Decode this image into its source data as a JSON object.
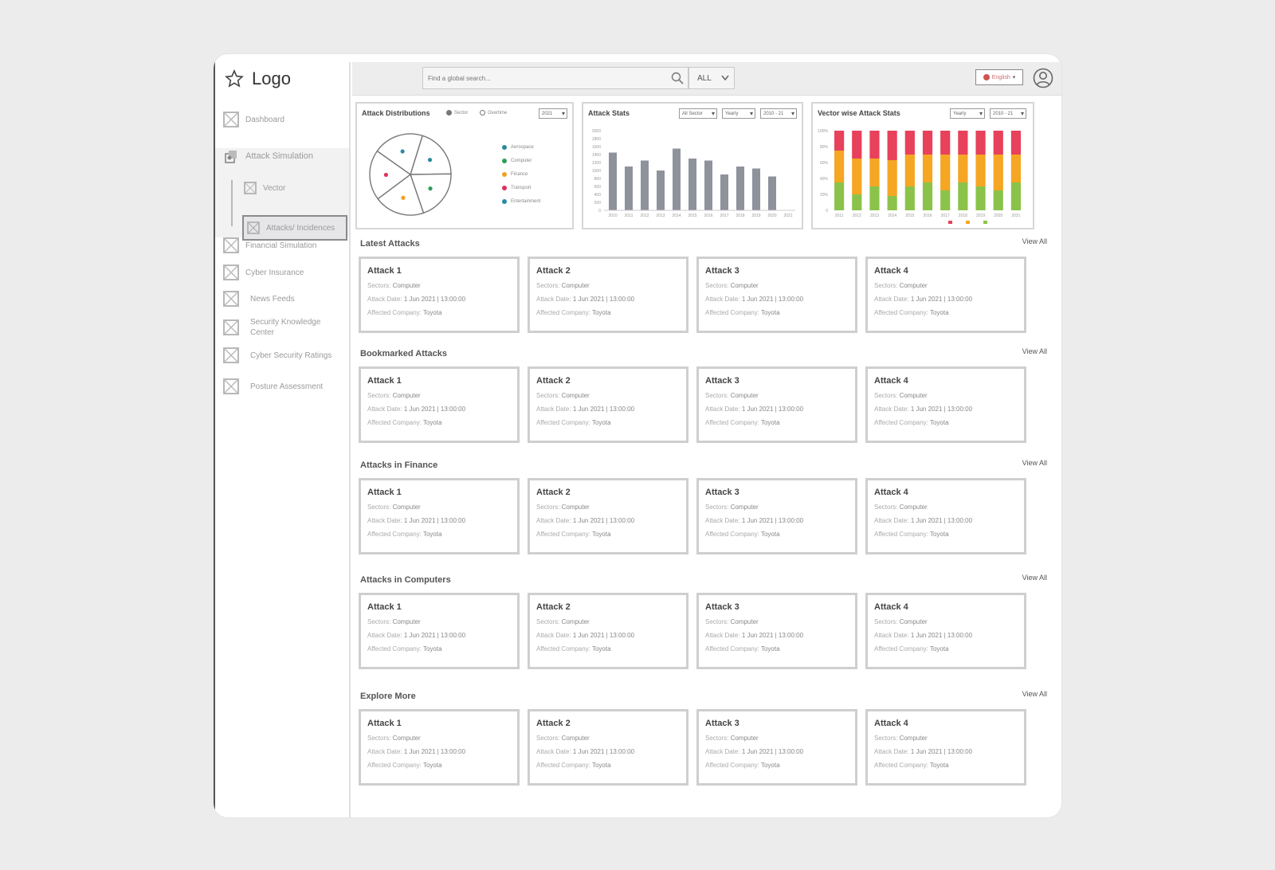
{
  "brand": {
    "logo_text": "Logo"
  },
  "sidebar": {
    "items": [
      {
        "label": "Dashboard",
        "icon": "placeholder-x-icon"
      },
      {
        "label": "Attack Simulation",
        "icon": "attack-simulation-icon"
      },
      {
        "label": "Vector",
        "icon": "placeholder-x-icon"
      },
      {
        "label": "Attacks/ Incidences",
        "icon": "placeholder-x-icon"
      },
      {
        "label": "Financial Simulation",
        "icon": "placeholder-x-icon"
      },
      {
        "label": "Cyber Insurance",
        "icon": "placeholder-x-icon"
      },
      {
        "label": "News Feeds",
        "icon": "placeholder-x-icon"
      },
      {
        "label": "Security Knowledge Center",
        "icon": "placeholder-x-icon"
      },
      {
        "label": "Cyber Security Ratings",
        "icon": "placeholder-x-icon"
      },
      {
        "label": "Posture Assessment",
        "icon": "placeholder-x-icon"
      }
    ]
  },
  "topbar": {
    "search_placeholder": "Find a global search...",
    "scope": "ALL",
    "language": "English"
  },
  "panels": {
    "distribution": {
      "title": "Attack Distributions",
      "radio_1": "Sector",
      "radio_2": "Overtime",
      "select": "2021",
      "legend": [
        "Aerospace",
        "Computer",
        "Finance",
        "Transport",
        "Entertainment"
      ]
    },
    "stats": {
      "title": "Attack Stats",
      "select_1": "All Sector",
      "select_2": "Yearly",
      "select_3": "2010 - 21"
    },
    "vector": {
      "title": "Vector wise Attack Stats",
      "select_1": "Yearly",
      "select_2": "2010 - 21"
    }
  },
  "chart_data": [
    {
      "type": "pie",
      "title": "Attack Distributions",
      "categories": [
        "Aerospace",
        "Computer",
        "Finance",
        "Transport",
        "Entertainment"
      ],
      "values": [
        20,
        20,
        20,
        20,
        20
      ]
    },
    {
      "type": "bar",
      "title": "Attack Stats",
      "categories": [
        "2010",
        "2011",
        "2012",
        "2013",
        "2014",
        "2015",
        "2016",
        "2017",
        "2018",
        "2019",
        "2020",
        "2021"
      ],
      "values": [
        1450,
        1100,
        1250,
        1000,
        1550,
        1300,
        1250,
        900,
        1100,
        1050,
        850,
        0
      ],
      "ylim": [
        0,
        2000
      ],
      "yticks": [
        "2000",
        "1800",
        "1600",
        "1400",
        "1200",
        "1000",
        "800",
        "600",
        "400",
        "200",
        "0"
      ]
    },
    {
      "type": "bar",
      "title": "Vector wise Attack Stats",
      "stacked": true,
      "categories": [
        "2011",
        "2012",
        "2013",
        "2014",
        "2015",
        "2016",
        "2017",
        "2018",
        "2019",
        "2020",
        "2021"
      ],
      "ylim": [
        0,
        100
      ],
      "yticks": [
        "100%",
        "80%",
        "60%",
        "40%",
        "20%",
        "0"
      ],
      "series": [
        {
          "color": "#8bc34a",
          "values": [
            35,
            20,
            30,
            18,
            30,
            35,
            25,
            35,
            30,
            25,
            35
          ]
        },
        {
          "color": "#f5a623",
          "values": [
            40,
            45,
            35,
            45,
            40,
            35,
            45,
            35,
            40,
            45,
            35
          ]
        },
        {
          "color": "#e8415b",
          "values": [
            25,
            35,
            35,
            37,
            30,
            30,
            30,
            30,
            30,
            30,
            30
          ]
        }
      ]
    }
  ],
  "sections": [
    {
      "title": "Latest Attacks",
      "view_all": "View All"
    },
    {
      "title": "Bookmarked Attacks",
      "view_all": "View All"
    },
    {
      "title": "Attacks in Finance",
      "view_all": "View All"
    },
    {
      "title": "Attacks in Computers",
      "view_all": "View All"
    },
    {
      "title": "Explore More",
      "view_all": "View All"
    }
  ],
  "cards": [
    {
      "title": "Attack 1",
      "sector_label": "Sectors:",
      "sector": "Computer",
      "date_label": "Attack Date:",
      "date": "1 Jun 2021 | 13:00:00",
      "company_label": "Affected Company:",
      "company": "Toyota"
    },
    {
      "title": "Attack 2",
      "sector_label": "Sectors:",
      "sector": "Computer",
      "date_label": "Attack Date:",
      "date": "1 Jun 2021 | 13:00:00",
      "company_label": "Affected Company:",
      "company": "Toyota"
    },
    {
      "title": "Attack 3",
      "sector_label": "Sectors:",
      "sector": "Computer",
      "date_label": "Attack Date:",
      "date": "1 Jun 2021 | 13:00:00",
      "company_label": "Affected Company:",
      "company": "Toyota"
    },
    {
      "title": "Attack 4",
      "sector_label": "Sectors:",
      "sector": "Computer",
      "date_label": "Attack Date:",
      "date": "1 Jun 2021 | 13:00:00",
      "company_label": "Affected Company:",
      "company": "Toyota"
    }
  ],
  "colors": {
    "legend": [
      "#2a8a9a",
      "#2e9e57",
      "#f0a020",
      "#e0305a",
      "#2a8aa8"
    ]
  }
}
